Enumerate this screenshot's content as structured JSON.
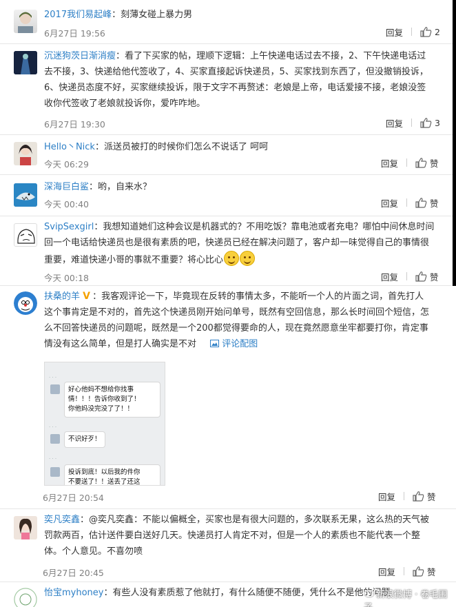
{
  "comments": [
    {
      "nick": "2017我们易起峰",
      "sep": "：",
      "text": "刻薄女碰上暴力男",
      "time": "6月27日 19:56",
      "reply": "回复",
      "likes": "2"
    },
    {
      "nick": "沉迷狗茨日渐消瘦",
      "sep": "：",
      "lines": [
        "看了下买家的帖，理顺下逻辑：上午快递电话过去不接，2、下午快递电话过",
        "去不接，3、快递给他代签收了，4、买家直接起诉快递员，5、买家找到东西了，但没撤销投诉，",
        "6、快递员态度不好，买家继续投诉，限于文字不再赘述：老娘是上帝，电话爱接不接，老娘没签",
        "收你代签收了老娘就投诉你，爱咋咋地。"
      ],
      "time": "6月27日 19:30",
      "reply": "回复",
      "likes": "3"
    },
    {
      "nick": "Hello丶Nick",
      "sep": "：",
      "text": "派送员被打的时候你们怎么不说话了   呵呵",
      "time": "今天 06:29",
      "reply": "回复",
      "likes": "赞"
    },
    {
      "nick": "深海巨白鲨",
      "sep": "：",
      "text": "哟，自来水？",
      "time": "今天 00:40",
      "reply": "回复",
      "likes": "赞"
    },
    {
      "nick": "SvipSexgirl",
      "sep": "：",
      "lines": [
        "我想知道她们这种会议是机器式的？不用吃饭？靠电池或者充电？哪怕中间休息时间",
        "回一个电话给快递员也是很有素质的吧，快递员已经在解决问题了，客户却一味觉得自己的事情很",
        "重要，难道快递小哥的事就不重要？将心比心"
      ],
      "time": "今天 00:18",
      "reply": "回复",
      "likes": "赞"
    },
    {
      "nick": "扶桑的羊",
      "sep": "：",
      "lines": [
        "我客观评论一下，毕竟现在反转的事情太多，不能听一个人的片面之词，首先打人",
        "这个事肯定是不对的，首先这个快递员刚开始问单号，既然有空回信息，那么长时间回个短信，怎",
        "么不回答快递员的问题呢，既然是一个200都觉得要命的人，现在竟然愿意坐牢都要打你，肯定事",
        "情没有这么简单，但是打人确实是不对"
      ],
      "pic_link": "评论配图",
      "time": "6月27日 20:54",
      "reply": "回复",
      "likes": "赞"
    },
    {
      "nick": "奕凡奕鑫",
      "sep": "：",
      "lines": [
        "@奕凡奕鑫：不能以偏概全，买家也是有很大问题的，多次联系无果，这么热的天气被",
        "罚款两百，估计送件要白送好几天。快递员打人肯定不对，但是一个人的素质也不能代表一个整",
        "体。个人意见。不喜勿喷"
      ],
      "time": "6月27日 20:45",
      "reply": "回复",
      "likes": "赞"
    },
    {
      "nick": "怡宝myhoney",
      "sep": "：",
      "text": "有些人没有素质惹了他就打，有什么随便不随便，凭什么不是他的问题"
    }
  ],
  "chat_screenshot": {
    "bubbles": [
      "好心他妈不想给你找事",
      "情！！！告诉你收到了！",
      "你他妈没完没了了！！",
      "不识好歹！",
      "投诉到底！以后我的件你",
      "不要送了！！送丢了还这"
    ]
  },
  "watermark": "新浪微博 · 卷毛围子"
}
